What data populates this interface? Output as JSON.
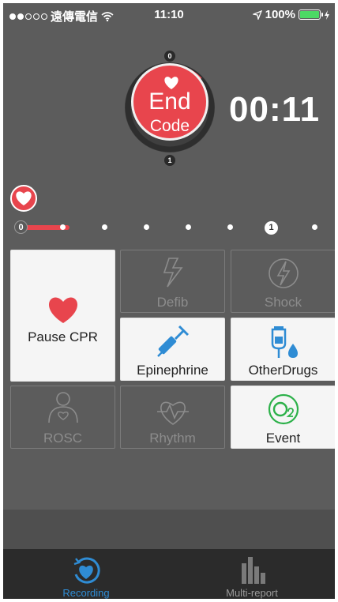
{
  "status_bar": {
    "carrier": "遠傳電信",
    "time": "11:10",
    "battery": "100%"
  },
  "timer": {
    "end_line1": "End",
    "end_line2": "Code",
    "elapsed": "00:11",
    "ring_top": "0",
    "ring_bottom": "1"
  },
  "cycles": {
    "start": "0",
    "current": "1"
  },
  "actions": {
    "pause_cpr": "Pause CPR",
    "defib": "Defib",
    "shock": "Shock",
    "epinephrine": "Epinephrine",
    "other_drugs": "OtherDrugs",
    "rosc": "ROSC",
    "rhythm": "Rhythm",
    "event": "Event"
  },
  "tabs": {
    "recording": "Recording",
    "multi_report": "Multi-report"
  },
  "colors": {
    "accent_red": "#e8454d",
    "accent_blue": "#2f8cd4",
    "accent_green": "#2db14a"
  }
}
